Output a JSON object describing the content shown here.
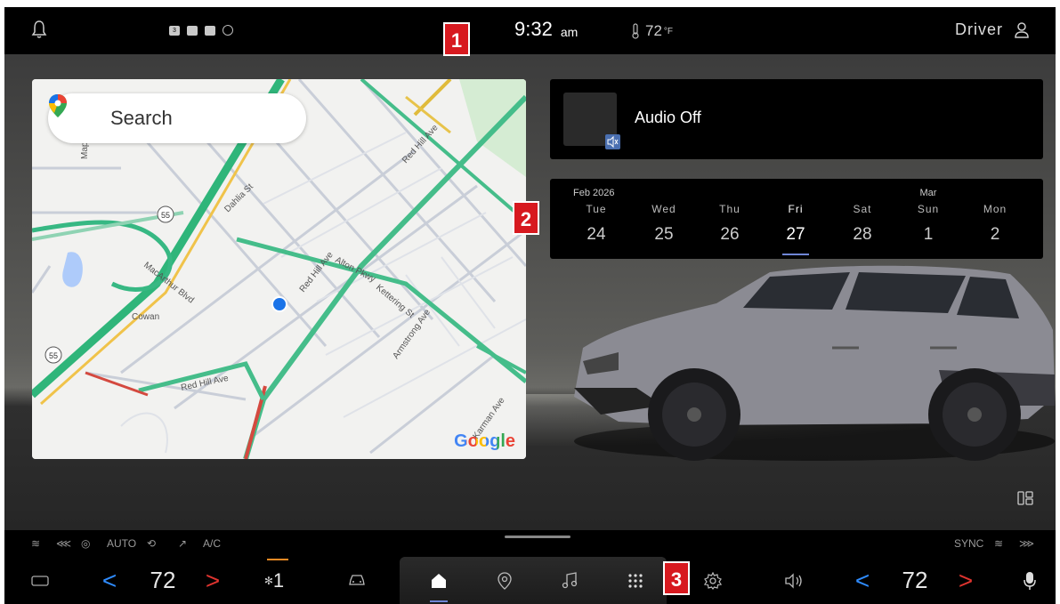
{
  "status_bar": {
    "time": "9:32",
    "ampm": "am",
    "outside_temp": "72",
    "outside_unit": "°F",
    "profile": "Driver",
    "message_count": "3"
  },
  "map": {
    "search_placeholder": "Search",
    "logo": "Google",
    "street_labels": [
      "Red Hill Ave",
      "Alton Pkwy",
      "Kettering St",
      "Armstrong Ave",
      "MacArthur Blvd",
      "Cowan",
      "Dahlia St",
      "Maple",
      "Karman Ave",
      "Red Hill Ave",
      "55",
      "55",
      "Red Hill Ave"
    ]
  },
  "audio": {
    "label": "Audio Off"
  },
  "calendar": {
    "days": [
      {
        "month": "Feb 2026",
        "dow": "Tue",
        "date": "24",
        "selected": false
      },
      {
        "month": "",
        "dow": "Wed",
        "date": "25",
        "selected": false
      },
      {
        "month": "",
        "dow": "Thu",
        "date": "26",
        "selected": false
      },
      {
        "month": "",
        "dow": "Fri",
        "date": "27",
        "selected": true
      },
      {
        "month": "",
        "dow": "Sat",
        "date": "28",
        "selected": false
      },
      {
        "month": "Mar",
        "dow": "Sun",
        "date": "1",
        "selected": false
      },
      {
        "month": "",
        "dow": "Mon",
        "date": "2",
        "selected": false
      }
    ]
  },
  "markers": [
    "1",
    "2",
    "3"
  ],
  "climate_row": {
    "auto_label": "AUTO",
    "ac_label": "A/C",
    "sync_label": "SYNC"
  },
  "dock": {
    "left_temp": "72",
    "right_temp": "72",
    "fan_speed": "1",
    "active_item": "home"
  },
  "colors": {
    "accent_blue": "#2f8cff",
    "accent_red": "#e0342f",
    "fan_orange": "#f08a24",
    "calendar_selected": "#6f86d6",
    "marker_red": "#d7191f"
  }
}
